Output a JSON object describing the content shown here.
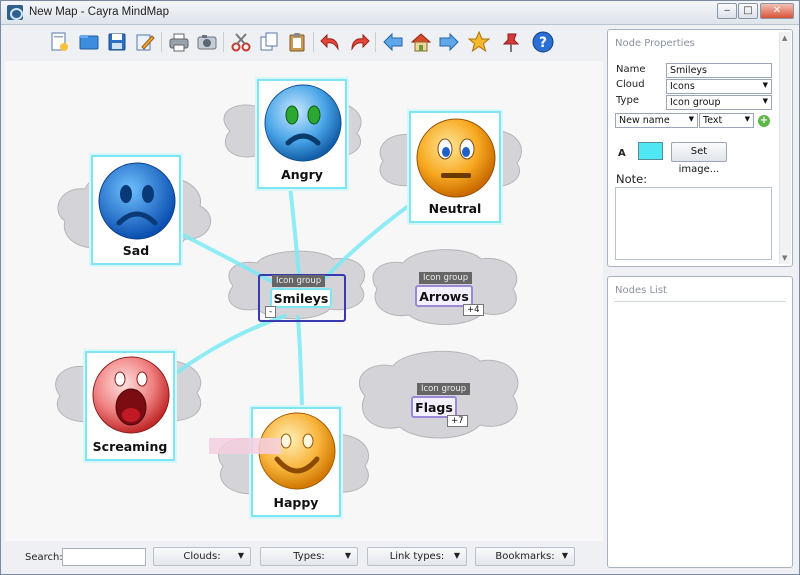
{
  "window": {
    "title": "New Map - Cayra MindMap"
  },
  "toolbar": {
    "buttons": [
      {
        "name": "new",
        "icon": "new-document-icon"
      },
      {
        "name": "open",
        "icon": "open-folder-icon"
      },
      {
        "name": "save",
        "icon": "save-disk-icon"
      },
      {
        "name": "edit",
        "icon": "edit-pencil-icon"
      },
      {
        "name": "print",
        "icon": "printer-icon"
      },
      {
        "name": "snapshot",
        "icon": "camera-icon"
      },
      {
        "name": "cut",
        "icon": "scissors-icon"
      },
      {
        "name": "copy",
        "icon": "copy-icon"
      },
      {
        "name": "paste",
        "icon": "clipboard-icon"
      },
      {
        "name": "undo",
        "icon": "undo-arrow-icon"
      },
      {
        "name": "redo",
        "icon": "redo-arrow-icon"
      },
      {
        "name": "back",
        "icon": "arrow-left-icon"
      },
      {
        "name": "home",
        "icon": "home-icon"
      },
      {
        "name": "forward",
        "icon": "arrow-right-icon"
      },
      {
        "name": "favorite",
        "icon": "star-icon"
      },
      {
        "name": "pin",
        "icon": "pushpin-icon"
      },
      {
        "name": "help",
        "icon": "help-icon"
      }
    ]
  },
  "map": {
    "center": {
      "tag": "Icon group",
      "label": "Smileys",
      "collapse": "-"
    },
    "nodes": [
      {
        "label": "Sad",
        "face": "sad"
      },
      {
        "label": "Angry",
        "face": "angry"
      },
      {
        "label": "Neutral",
        "face": "neutral"
      },
      {
        "label": "Screaming",
        "face": "screaming"
      },
      {
        "label": "Happy",
        "face": "happy"
      }
    ],
    "groups": [
      {
        "tag": "Icon group",
        "label": "Arrows",
        "count": "+4"
      },
      {
        "tag": "Icon group",
        "label": "Flags",
        "count": "+7"
      }
    ]
  },
  "bottombar": {
    "search_label": "Search:",
    "search_value": "",
    "dropdowns": [
      "Clouds:",
      "Types:",
      "Link types:",
      "Bookmarks:"
    ]
  },
  "properties": {
    "title": "Node Properties",
    "name_label": "Name",
    "name_value": "Smileys",
    "cloud_label": "Cloud",
    "cloud_value": "Icons",
    "type_label": "Type",
    "type_value": "Icon group",
    "new_name_value": "New name",
    "text_value": "Text",
    "color_label": "A",
    "color_swatch": "#4fe8f2",
    "set_image_label": "Set image...",
    "note_label": "Note:",
    "note_value": ""
  },
  "nodes_list": {
    "title": "Nodes List"
  },
  "colors": {
    "node_border": "#7ee6f2",
    "link": "#7de9f4",
    "group_border": "#9a88d8",
    "cloud": "#d4d4d8"
  }
}
